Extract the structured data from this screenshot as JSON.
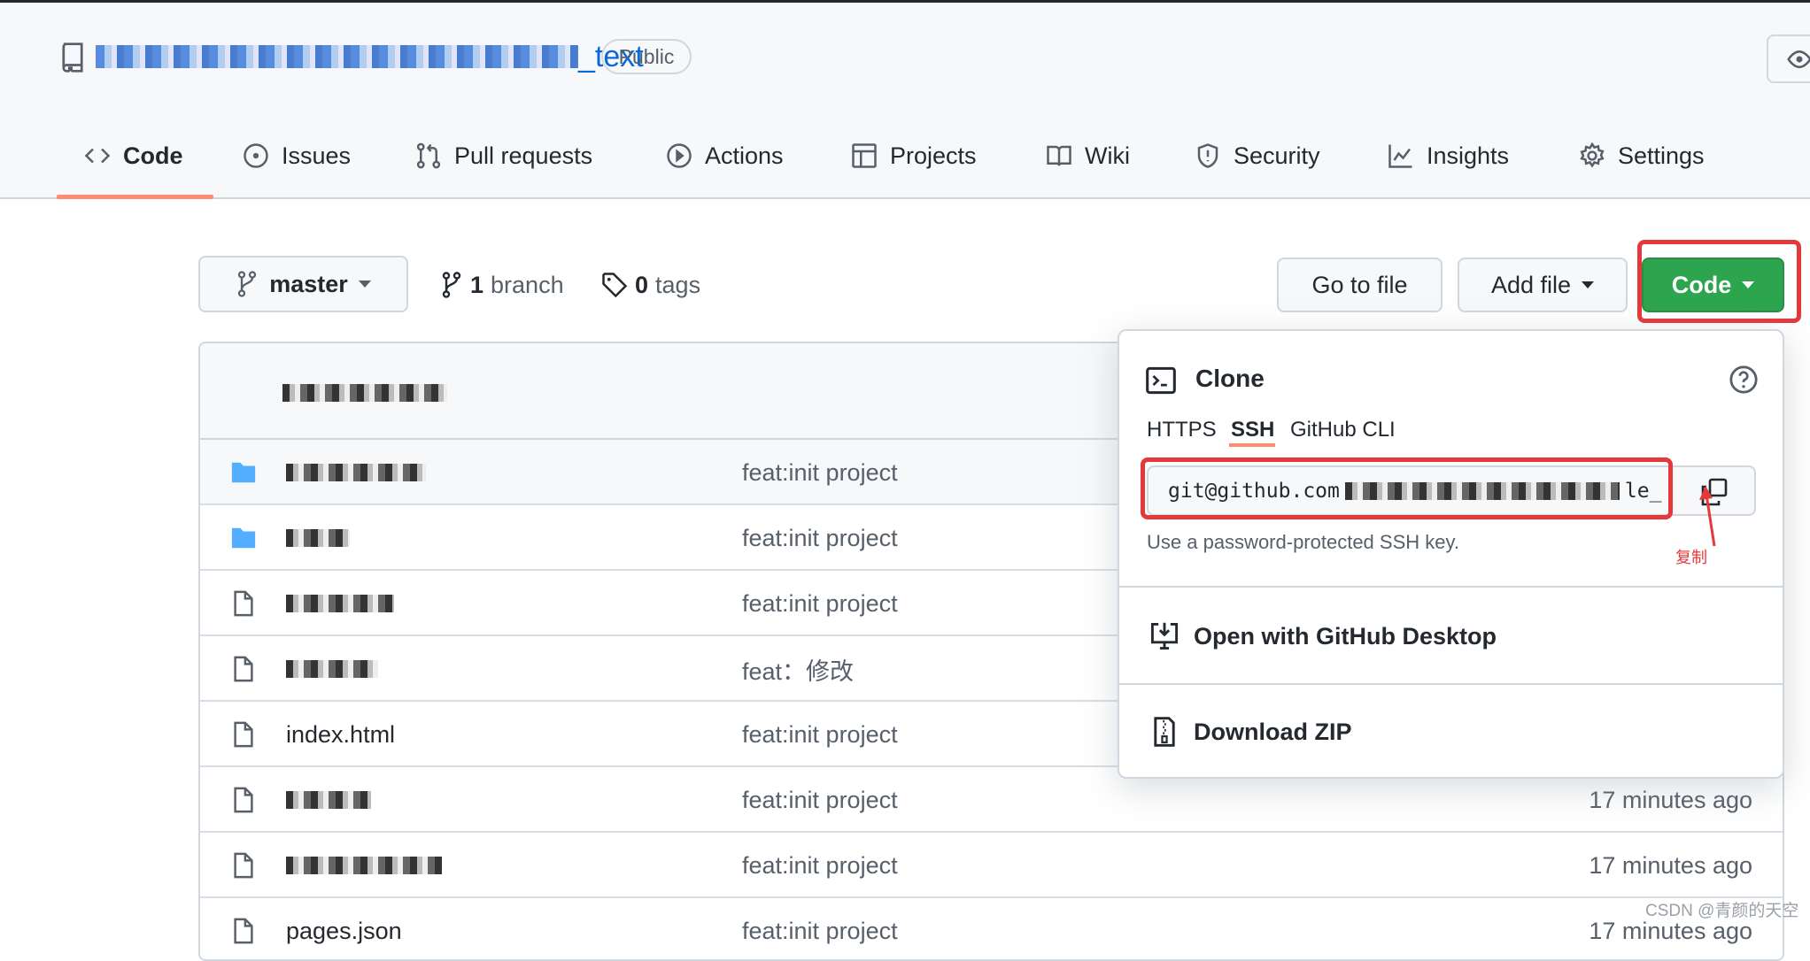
{
  "repo": {
    "title_visible_suffix": "_text",
    "visibility": "Public"
  },
  "tabs": [
    {
      "label": "Code",
      "icon": "code-icon"
    },
    {
      "label": "Issues",
      "icon": "issue-icon"
    },
    {
      "label": "Pull requests",
      "icon": "pull-request-icon"
    },
    {
      "label": "Actions",
      "icon": "play-icon"
    },
    {
      "label": "Projects",
      "icon": "table-icon"
    },
    {
      "label": "Wiki",
      "icon": "book-icon"
    },
    {
      "label": "Security",
      "icon": "shield-icon"
    },
    {
      "label": "Insights",
      "icon": "graph-icon"
    },
    {
      "label": "Settings",
      "icon": "gear-icon"
    }
  ],
  "toolbar": {
    "branch": "master",
    "branch_count": "1",
    "branch_label": "branch",
    "tag_count": "0",
    "tag_label": "tags",
    "go_to_file": "Go to file",
    "add_file": "Add file",
    "code": "Code"
  },
  "files": [
    {
      "type": "folder",
      "name": "",
      "message": "feat:init project",
      "time": ""
    },
    {
      "type": "folder",
      "name": "",
      "message": "feat:init project",
      "time": ""
    },
    {
      "type": "file",
      "name": "",
      "message": "feat:init project",
      "time": ""
    },
    {
      "type": "file",
      "name": "",
      "message": "feat：修改",
      "time": ""
    },
    {
      "type": "file",
      "name": "index.html",
      "message": "feat:init project",
      "time": ""
    },
    {
      "type": "file",
      "name": "",
      "message": "feat:init project",
      "time": "17 minutes ago"
    },
    {
      "type": "file",
      "name": "",
      "message": "feat:init project",
      "time": "17 minutes ago"
    },
    {
      "type": "file",
      "name": "pages.json",
      "message": "feat:init project",
      "time": "17 minutes ago"
    }
  ],
  "clone": {
    "title": "Clone",
    "tabs": [
      "HTTPS",
      "SSH",
      "GitHub CLI"
    ],
    "active_tab": "SSH",
    "url_prefix": "git@github.com",
    "url_suffix": "le_",
    "hint": "Use a password-protected SSH key.",
    "annotation": "复制",
    "open_desktop": "Open with GitHub Desktop",
    "download_zip": "Download ZIP"
  },
  "colors": {
    "accent": "#fd8c73",
    "green": "#2da44e",
    "annotation_red": "#e5383b",
    "link": "#0969da"
  },
  "watermark": "CSDN @青颜的天空"
}
